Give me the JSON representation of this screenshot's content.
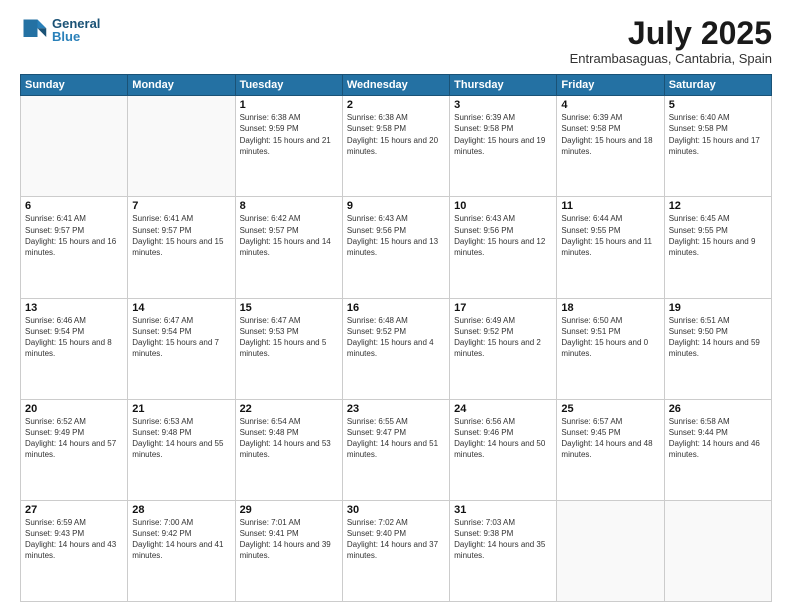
{
  "header": {
    "logo_line1": "General",
    "logo_line2": "Blue",
    "month_title": "July 2025",
    "subtitle": "Entrambasaguas, Cantabria, Spain"
  },
  "weekdays": [
    "Sunday",
    "Monday",
    "Tuesday",
    "Wednesday",
    "Thursday",
    "Friday",
    "Saturday"
  ],
  "weeks": [
    [
      {
        "day": "",
        "text": ""
      },
      {
        "day": "",
        "text": ""
      },
      {
        "day": "1",
        "text": "Sunrise: 6:38 AM\nSunset: 9:59 PM\nDaylight: 15 hours and 21 minutes."
      },
      {
        "day": "2",
        "text": "Sunrise: 6:38 AM\nSunset: 9:58 PM\nDaylight: 15 hours and 20 minutes."
      },
      {
        "day": "3",
        "text": "Sunrise: 6:39 AM\nSunset: 9:58 PM\nDaylight: 15 hours and 19 minutes."
      },
      {
        "day": "4",
        "text": "Sunrise: 6:39 AM\nSunset: 9:58 PM\nDaylight: 15 hours and 18 minutes."
      },
      {
        "day": "5",
        "text": "Sunrise: 6:40 AM\nSunset: 9:58 PM\nDaylight: 15 hours and 17 minutes."
      }
    ],
    [
      {
        "day": "6",
        "text": "Sunrise: 6:41 AM\nSunset: 9:57 PM\nDaylight: 15 hours and 16 minutes."
      },
      {
        "day": "7",
        "text": "Sunrise: 6:41 AM\nSunset: 9:57 PM\nDaylight: 15 hours and 15 minutes."
      },
      {
        "day": "8",
        "text": "Sunrise: 6:42 AM\nSunset: 9:57 PM\nDaylight: 15 hours and 14 minutes."
      },
      {
        "day": "9",
        "text": "Sunrise: 6:43 AM\nSunset: 9:56 PM\nDaylight: 15 hours and 13 minutes."
      },
      {
        "day": "10",
        "text": "Sunrise: 6:43 AM\nSunset: 9:56 PM\nDaylight: 15 hours and 12 minutes."
      },
      {
        "day": "11",
        "text": "Sunrise: 6:44 AM\nSunset: 9:55 PM\nDaylight: 15 hours and 11 minutes."
      },
      {
        "day": "12",
        "text": "Sunrise: 6:45 AM\nSunset: 9:55 PM\nDaylight: 15 hours and 9 minutes."
      }
    ],
    [
      {
        "day": "13",
        "text": "Sunrise: 6:46 AM\nSunset: 9:54 PM\nDaylight: 15 hours and 8 minutes."
      },
      {
        "day": "14",
        "text": "Sunrise: 6:47 AM\nSunset: 9:54 PM\nDaylight: 15 hours and 7 minutes."
      },
      {
        "day": "15",
        "text": "Sunrise: 6:47 AM\nSunset: 9:53 PM\nDaylight: 15 hours and 5 minutes."
      },
      {
        "day": "16",
        "text": "Sunrise: 6:48 AM\nSunset: 9:52 PM\nDaylight: 15 hours and 4 minutes."
      },
      {
        "day": "17",
        "text": "Sunrise: 6:49 AM\nSunset: 9:52 PM\nDaylight: 15 hours and 2 minutes."
      },
      {
        "day": "18",
        "text": "Sunrise: 6:50 AM\nSunset: 9:51 PM\nDaylight: 15 hours and 0 minutes."
      },
      {
        "day": "19",
        "text": "Sunrise: 6:51 AM\nSunset: 9:50 PM\nDaylight: 14 hours and 59 minutes."
      }
    ],
    [
      {
        "day": "20",
        "text": "Sunrise: 6:52 AM\nSunset: 9:49 PM\nDaylight: 14 hours and 57 minutes."
      },
      {
        "day": "21",
        "text": "Sunrise: 6:53 AM\nSunset: 9:48 PM\nDaylight: 14 hours and 55 minutes."
      },
      {
        "day": "22",
        "text": "Sunrise: 6:54 AM\nSunset: 9:48 PM\nDaylight: 14 hours and 53 minutes."
      },
      {
        "day": "23",
        "text": "Sunrise: 6:55 AM\nSunset: 9:47 PM\nDaylight: 14 hours and 51 minutes."
      },
      {
        "day": "24",
        "text": "Sunrise: 6:56 AM\nSunset: 9:46 PM\nDaylight: 14 hours and 50 minutes."
      },
      {
        "day": "25",
        "text": "Sunrise: 6:57 AM\nSunset: 9:45 PM\nDaylight: 14 hours and 48 minutes."
      },
      {
        "day": "26",
        "text": "Sunrise: 6:58 AM\nSunset: 9:44 PM\nDaylight: 14 hours and 46 minutes."
      }
    ],
    [
      {
        "day": "27",
        "text": "Sunrise: 6:59 AM\nSunset: 9:43 PM\nDaylight: 14 hours and 43 minutes."
      },
      {
        "day": "28",
        "text": "Sunrise: 7:00 AM\nSunset: 9:42 PM\nDaylight: 14 hours and 41 minutes."
      },
      {
        "day": "29",
        "text": "Sunrise: 7:01 AM\nSunset: 9:41 PM\nDaylight: 14 hours and 39 minutes."
      },
      {
        "day": "30",
        "text": "Sunrise: 7:02 AM\nSunset: 9:40 PM\nDaylight: 14 hours and 37 minutes."
      },
      {
        "day": "31",
        "text": "Sunrise: 7:03 AM\nSunset: 9:38 PM\nDaylight: 14 hours and 35 minutes."
      },
      {
        "day": "",
        "text": ""
      },
      {
        "day": "",
        "text": ""
      }
    ]
  ]
}
